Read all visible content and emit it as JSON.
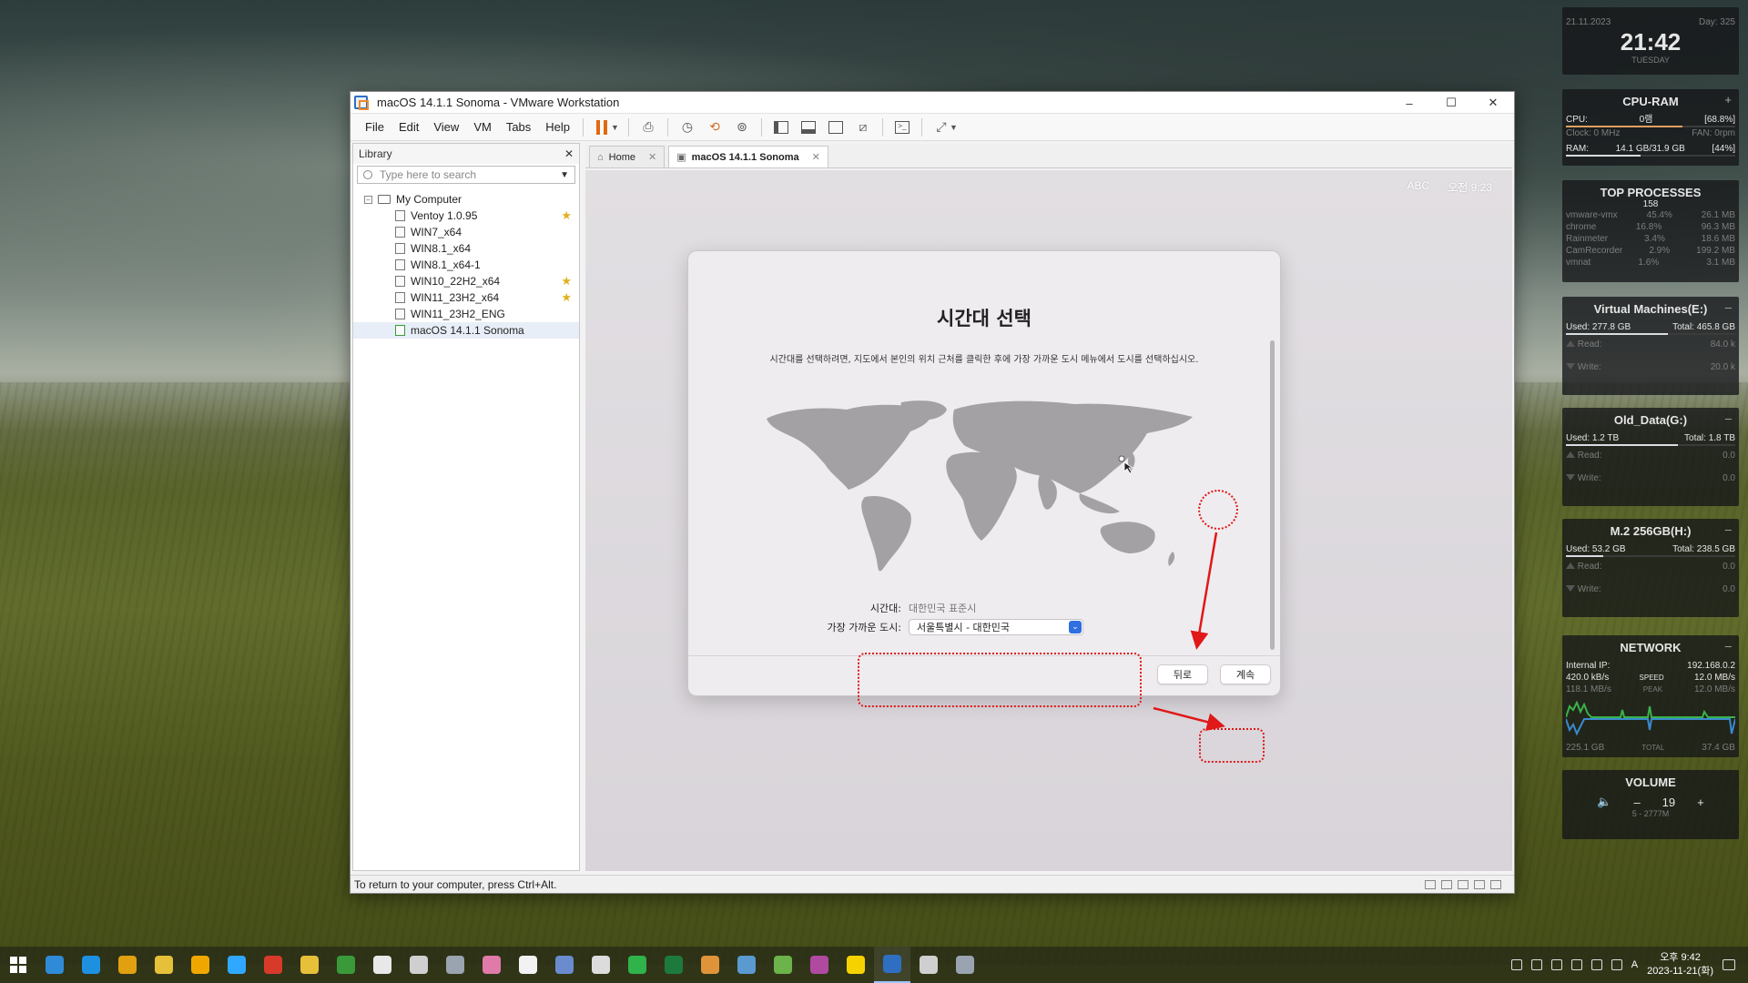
{
  "window": {
    "title": "macOS 14.1.1 Sonoma - VMware Workstation",
    "controls": [
      "–",
      "☐",
      "✕"
    ]
  },
  "menu": [
    "File",
    "Edit",
    "View",
    "VM",
    "Tabs",
    "Help"
  ],
  "library": {
    "title": "Library",
    "close": "✕",
    "search_placeholder": "Type here to search",
    "root": "My Computer",
    "items": [
      {
        "label": "Ventoy 1.0.95",
        "star": true
      },
      {
        "label": "WIN7_x64",
        "star": false
      },
      {
        "label": "WIN8.1_x64",
        "star": false
      },
      {
        "label": "WIN8.1_x64-1",
        "star": false
      },
      {
        "label": "WIN10_22H2_x64",
        "star": true
      },
      {
        "label": "WIN11_23H2_x64",
        "star": true
      },
      {
        "label": "WIN11_23H2_ENG",
        "star": false
      },
      {
        "label": "macOS 14.1.1 Sonoma",
        "star": false,
        "selected": true
      }
    ]
  },
  "tabs": [
    {
      "label": "Home",
      "icon": "home-icon"
    },
    {
      "label": "macOS 14.1.1 Sonoma",
      "icon": "vm-icon",
      "active": true
    }
  ],
  "guest": {
    "input_indicator": "ABC",
    "clock": "오전 9:23",
    "dialog": {
      "title": "시간대 선택",
      "description": "시간대를 선택하려면, 지도에서 본인의 위치 근처를 클릭한 후에 가장 가까운 도시 메뉴에서 도시를 선택하십시오.",
      "timezone_label": "시간대:",
      "timezone_value": "대한민국 표준시",
      "city_label": "가장 가까운 도시:",
      "city_value": "서울특별시 - 대한민국",
      "back_button": "뒤로",
      "continue_button": "계속"
    }
  },
  "statusbar": "To return to your computer, press Ctrl+Alt.",
  "rainmeter": {
    "clock": {
      "date": "21.11.2023",
      "day": "Day: 325",
      "time": "21:42",
      "weekday": "TUESDAY"
    },
    "cpu_ram": {
      "title": "CPU-RAM",
      "cpu_label": "CPU:",
      "cpu_name": "0램",
      "cpu_pct": "[68.8%]",
      "clock_label": "Clock: 0 MHz",
      "fan_label": "FAN: 0rpm",
      "ram_label": "RAM:",
      "ram_value": "14.1 GB/31.9 GB",
      "ram_pct": "[44%]",
      "cpu_level": 0.688,
      "ram_level": 0.44
    },
    "top": {
      "title": "TOP PROCESSES",
      "count": "158",
      "rows": [
        {
          "name": "vmware-vmx",
          "pct": "45.4%",
          "mem": "26.1 MB"
        },
        {
          "name": "chrome",
          "pct": "16.8%",
          "mem": "96.3 MB"
        },
        {
          "name": "Rainmeter",
          "pct": "3.4%",
          "mem": "18.6 MB"
        },
        {
          "name": "CamRecorder",
          "pct": "2.9%",
          "mem": "199.2 MB"
        },
        {
          "name": "vmnat",
          "pct": "1.6%",
          "mem": "3.1 MB"
        }
      ]
    },
    "drives": [
      {
        "title": "Virtual Machines(E:)",
        "used": "Used: 277.8 GB",
        "total": "Total: 465.8 GB",
        "read": "Read:",
        "read_val": "84.0 k",
        "write": "Write:",
        "write_val": "20.0 k",
        "level": 0.6
      },
      {
        "title": "Old_Data(G:)",
        "used": "Used: 1.2 TB",
        "total": "Total: 1.8 TB",
        "read": "Read:",
        "read_val": "0.0",
        "write": "Write:",
        "write_val": "0.0",
        "level": 0.66
      },
      {
        "title": "M.2 256GB(H:)",
        "used": "Used: 53.2 GB",
        "total": "Total: 238.5 GB",
        "read": "Read:",
        "read_val": "0.0",
        "write": "Write:",
        "write_val": "0.0",
        "level": 0.22
      }
    ],
    "network": {
      "title": "NETWORK",
      "ip_label": "Internal IP:",
      "ip": "192.168.0.2",
      "up": "420.0 kB/s",
      "speed_label": "SPEED",
      "speed": "12.0 MB/s",
      "down": "118.1 MB/s",
      "peak_label": "PEAK",
      "peak": "12.0 MB/s",
      "total_left": "225.1 GB",
      "total_label": "TOTAL",
      "total_right": "37.4 GB"
    },
    "volume": {
      "title": "VOLUME",
      "value": "19",
      "minus": "–",
      "plus": "+",
      "device": "5 - 2777M"
    }
  },
  "taskbar": {
    "apps": [
      "#2f8ad8",
      "#1e90e0",
      "#e0a010",
      "#e7c03a",
      "#f0a800",
      "#31a8ff",
      "#d83a2a",
      "#e7c03a",
      "#3a9a3a",
      "#e8e8e8",
      "#cfcfcf",
      "#9aa4b0",
      "#e07aa8",
      "#f2f2f2",
      "#6a8ccf",
      "#dcdcdc",
      "#2fb34a",
      "#1d7a3d",
      "#e0943a",
      "#5a9ad0",
      "#6bb34a",
      "#b04aa0",
      "#f6d300",
      "#2f6fc2",
      "#cfcfcf",
      "#9aa4b0"
    ],
    "clock_time": "오후 9:42",
    "clock_date": "2023-11-21(화)",
    "lang": "A"
  },
  "colors": {
    "annotation_red": "#e01818",
    "mac_blue": "#2f6fe0",
    "pause_orange": "#e06a10"
  }
}
